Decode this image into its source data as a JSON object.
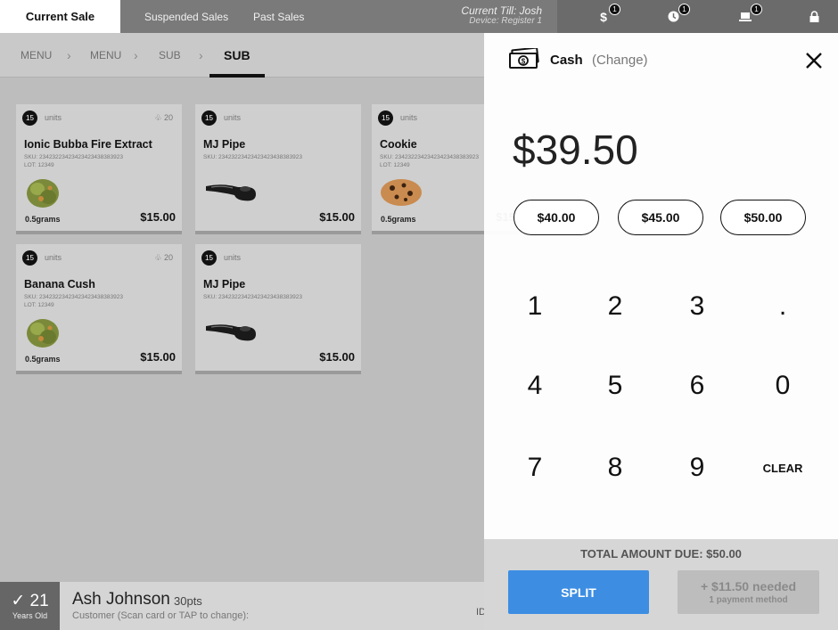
{
  "topbar": {
    "tabs": [
      "Current Sale",
      "Suspended Sales",
      "Past Sales"
    ],
    "till": "Current Till: Josh",
    "device": "Device: Register 1",
    "icons": [
      {
        "name": "dollar-icon",
        "badge": "1"
      },
      {
        "name": "clock-icon",
        "badge": "1"
      },
      {
        "name": "laptop-icon",
        "badge": "1"
      },
      {
        "name": "lock-icon",
        "badge": ""
      }
    ]
  },
  "breadcrumb": [
    "MENU",
    "MENU",
    "SUB",
    "SUB"
  ],
  "products": [
    {
      "units": "15",
      "units_label": "units",
      "stock": "20",
      "name": "Ionic Bubba Fire Extract",
      "sku": "SKU: 23423223423423423438383923",
      "lot": "LOT: 12349",
      "qty": "0.5grams",
      "price": "$15.00",
      "img": "flower"
    },
    {
      "units": "15",
      "units_label": "units",
      "stock": "",
      "name": "MJ Pipe",
      "sku": "SKU: 23423223423423423438383923",
      "lot": "",
      "qty": "",
      "price": "$15.00",
      "img": "pipe"
    },
    {
      "units": "15",
      "units_label": "units",
      "stock": "",
      "name": "Cookie",
      "sku": "SKU: 23423223423423423438383923",
      "lot": "LOT: 12349",
      "qty": "0.5grams",
      "price": "$15.00",
      "img": "cookie"
    },
    {
      "units": "15",
      "units_label": "units",
      "stock": "20",
      "name": "Banana Cush",
      "sku": "SKU: 23423223423423423438383923",
      "lot": "LOT: 12349",
      "qty": "0.5grams",
      "price": "$15.00",
      "img": "flower"
    },
    {
      "units": "15",
      "units_label": "units",
      "stock": "",
      "name": "MJ Pipe",
      "sku": "SKU: 23423223423423423438383923",
      "lot": "",
      "qty": "",
      "price": "$15.00",
      "img": "pipe"
    }
  ],
  "customer": {
    "age": "21",
    "age_label": "Years Old",
    "name": "Ash Johnson",
    "points": "30pts",
    "hint": "Customer (Scan card or TAP to change):",
    "id_label": "ID"
  },
  "payment": {
    "title": "Cash",
    "subtitle": "(Change)",
    "amount": "$39.50",
    "quick_amounts": [
      "$40.00",
      "$45.00",
      "$50.00"
    ],
    "keys": [
      "1",
      "2",
      "3",
      ".",
      "4",
      "5",
      "6",
      "0",
      "7",
      "8",
      "9",
      "CLEAR"
    ],
    "total_due": "TOTAL AMOUNT DUE: $50.00",
    "split_label": "SPLIT",
    "needed_label": "+ $11.50 needed",
    "needed_sub": "1 payment method"
  },
  "colors": {
    "accent": "#3d8ee3",
    "topbar": "#7a7a7a"
  }
}
